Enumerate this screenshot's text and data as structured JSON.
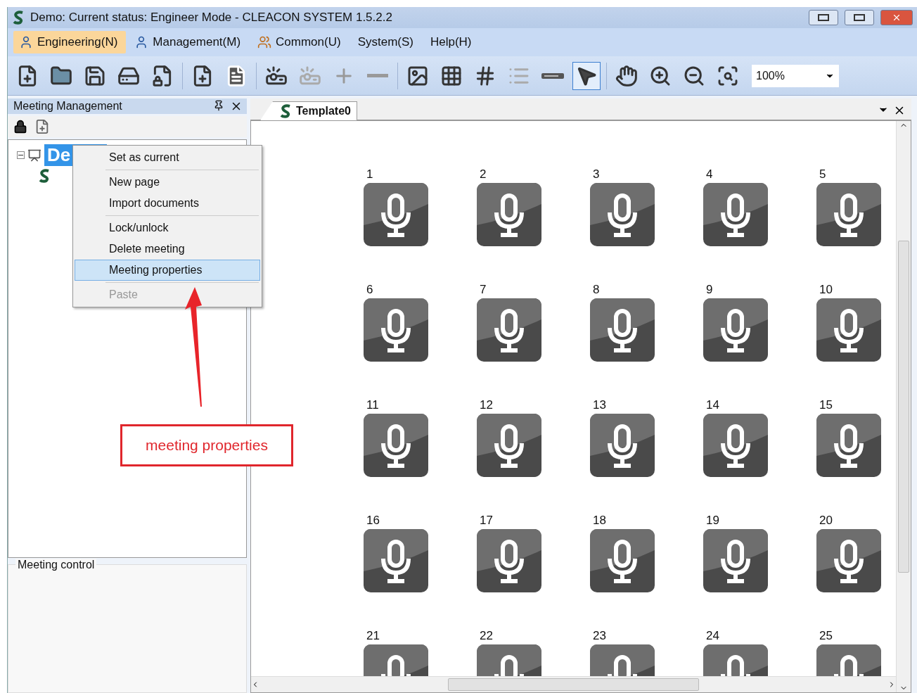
{
  "window": {
    "title": "Demo: Current status: Engineer Mode - CLEACON SYSTEM 1.5.2.2"
  },
  "menu": [
    {
      "label": "Engineering(N)",
      "kind": "engineer",
      "selected": true
    },
    {
      "label": "Management(M)",
      "kind": "manager",
      "selected": false
    },
    {
      "label": "Common(U)",
      "kind": "users",
      "selected": false
    },
    {
      "label": "System(S)",
      "kind": "plain",
      "selected": false
    },
    {
      "label": "Help(H)",
      "kind": "plain",
      "selected": false
    }
  ],
  "toolbar": {
    "zoom": "100%",
    "tools": [
      {
        "kind": "new-meeting"
      },
      {
        "kind": "folder"
      },
      {
        "kind": "save"
      },
      {
        "kind": "save-all"
      },
      {
        "kind": "lock-doc"
      },
      {
        "kind": "sep"
      },
      {
        "kind": "new-page"
      },
      {
        "kind": "pdf"
      },
      {
        "kind": "sep"
      },
      {
        "kind": "projector",
        "disabled": false
      },
      {
        "kind": "projector",
        "disabled": true
      },
      {
        "kind": "plus"
      },
      {
        "kind": "minus"
      },
      {
        "kind": "sep"
      },
      {
        "kind": "image"
      },
      {
        "kind": "grid"
      },
      {
        "kind": "mesh"
      },
      {
        "kind": "id-list"
      },
      {
        "kind": "device"
      },
      {
        "kind": "pointer",
        "selected": true
      },
      {
        "kind": "sep"
      },
      {
        "kind": "hand"
      },
      {
        "kind": "zoom-in"
      },
      {
        "kind": "zoom-out"
      },
      {
        "kind": "zoom-area"
      }
    ]
  },
  "left_panel": {
    "title": "Meeting Management",
    "tree": [
      {
        "label": "De",
        "kind": "meeting",
        "selected": true,
        "expanded": true,
        "children": [
          {
            "kind": "page"
          }
        ]
      }
    ],
    "control_title": "Meeting control"
  },
  "context_menu": [
    {
      "items": [
        {
          "label": "Set as current",
          "selected": false,
          "disabled": false
        }
      ]
    },
    {
      "items": [
        {
          "label": "New page",
          "selected": false,
          "disabled": false
        },
        {
          "label": "Import documents",
          "selected": false,
          "disabled": false
        }
      ]
    },
    {
      "items": [
        {
          "label": "Lock/unlock",
          "selected": false,
          "disabled": false
        },
        {
          "label": "Delete meeting",
          "selected": false,
          "disabled": false
        },
        {
          "label": "Meeting properties",
          "selected": true,
          "disabled": false
        }
      ]
    },
    {
      "items": [
        {
          "label": "Paste",
          "selected": false,
          "disabled": true
        }
      ]
    }
  ],
  "document": {
    "tab": "Template0",
    "seats": [
      "1",
      "2",
      "3",
      "4",
      "5",
      "6",
      "7",
      "8",
      "9",
      "10",
      "11",
      "12",
      "13",
      "14",
      "15",
      "16",
      "17",
      "18",
      "19",
      "20",
      "21",
      "22",
      "23",
      "24",
      "25"
    ]
  },
  "annotation": {
    "text": "meeting properties"
  }
}
